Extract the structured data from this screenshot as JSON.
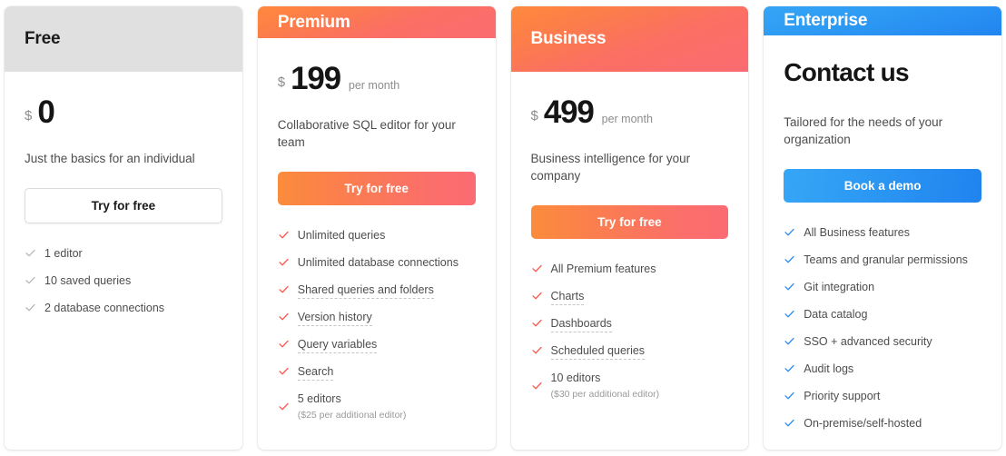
{
  "colors": {
    "free_header_bg": "#e0e0e0",
    "warm_gradient_start": "#ff8a3d",
    "warm_gradient_end": "#fb6b72",
    "blue_gradient_start": "#35a4f5",
    "blue_gradient_end": "#2185f0",
    "check_red": "#fb5a52",
    "check_blue": "#2f8ef4",
    "check_gray": "#b0b0b0",
    "text_dark": "#151515",
    "text_body": "#4d4d4d",
    "text_muted": "#8c8c8c"
  },
  "plans": [
    {
      "id": "free",
      "name": "Free",
      "currency": "$",
      "amount": "0",
      "period": "",
      "description": "Just the basics for an individual",
      "cta_label": "Try for free",
      "check_icon": "check-icon",
      "features": [
        {
          "label": "1 editor",
          "note": "",
          "tooltip": false
        },
        {
          "label": "10 saved queries",
          "note": "",
          "tooltip": false
        },
        {
          "label": "2 database connections",
          "note": "",
          "tooltip": false
        }
      ]
    },
    {
      "id": "premium",
      "name": "Premium",
      "currency": "$",
      "amount": "199",
      "period": "per month",
      "description": "Collaborative SQL editor for your team",
      "cta_label": "Try for free",
      "check_icon": "check-icon",
      "features": [
        {
          "label": "Unlimited queries",
          "note": "",
          "tooltip": false
        },
        {
          "label": "Unlimited database connections",
          "note": "",
          "tooltip": false
        },
        {
          "label": "Shared queries and folders",
          "note": "",
          "tooltip": true
        },
        {
          "label": "Version history",
          "note": "",
          "tooltip": true
        },
        {
          "label": "Query variables",
          "note": "",
          "tooltip": true
        },
        {
          "label": "Search",
          "note": "",
          "tooltip": true
        },
        {
          "label": "5 editors",
          "note": "($25 per additional editor)",
          "tooltip": false
        }
      ]
    },
    {
      "id": "business",
      "name": "Business",
      "currency": "$",
      "amount": "499",
      "period": "per month",
      "description": "Business intelligence for your company",
      "cta_label": "Try for free",
      "check_icon": "check-icon",
      "features": [
        {
          "label": "All Premium features",
          "note": "",
          "tooltip": false
        },
        {
          "label": "Charts",
          "note": "",
          "tooltip": true
        },
        {
          "label": "Dashboards",
          "note": "",
          "tooltip": true
        },
        {
          "label": "Scheduled queries",
          "note": "",
          "tooltip": true
        },
        {
          "label": "10 editors",
          "note": "($30 per additional editor)",
          "tooltip": false
        }
      ]
    },
    {
      "id": "enterprise",
      "name": "Enterprise",
      "currency": "",
      "amount": "Contact us",
      "period": "",
      "description": "Tailored for the needs of your organization",
      "cta_label": "Book a demo",
      "check_icon": "check-icon",
      "features": [
        {
          "label": "All Business features",
          "note": "",
          "tooltip": false
        },
        {
          "label": "Teams and granular permissions",
          "note": "",
          "tooltip": false
        },
        {
          "label": "Git integration",
          "note": "",
          "tooltip": false
        },
        {
          "label": "Data catalog",
          "note": "",
          "tooltip": false
        },
        {
          "label": "SSO + advanced security",
          "note": "",
          "tooltip": false
        },
        {
          "label": "Audit logs",
          "note": "",
          "tooltip": false
        },
        {
          "label": "Priority support",
          "note": "",
          "tooltip": false
        },
        {
          "label": "On-premise/self-hosted",
          "note": "",
          "tooltip": false
        }
      ]
    }
  ]
}
